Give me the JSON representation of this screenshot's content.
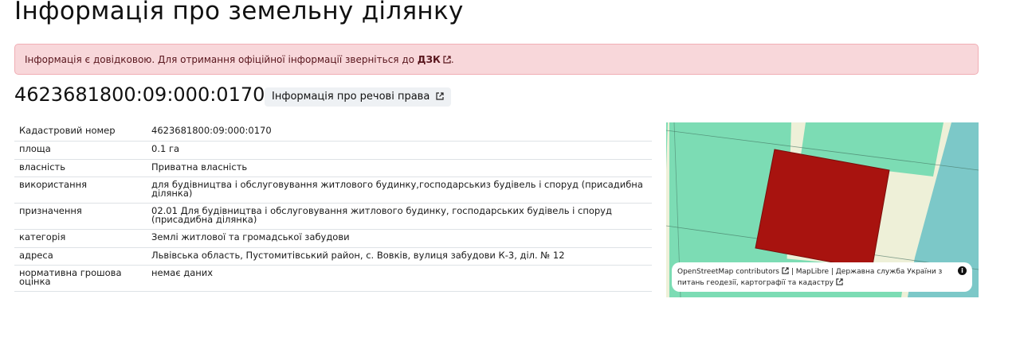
{
  "page": {
    "title": "Інформація про земельну ділянку"
  },
  "alert": {
    "text": "Інформація є довідковою. Для отримання офіційної інформації зверніться до ",
    "link_label": "ДЗК",
    "suffix": "."
  },
  "parcel": {
    "cadastral_number": "4623681800:09:000:0170",
    "rights_button_label": "Інформація про речові права"
  },
  "info_table": {
    "rows": [
      {
        "label": "Кадастровий номер",
        "value": "4623681800:09:000:0170"
      },
      {
        "label": "площа",
        "value": "0.1 га"
      },
      {
        "label": "власність",
        "value": "Приватна власність"
      },
      {
        "label": "використання",
        "value": "для будівництва і обслуговування житлового будинку,господарськиз будівель і споруд (присадибна ділянка)"
      },
      {
        "label": "призначення",
        "value": "02.01 Для будівництва і обслуговування житлового будинку, господарських будівель і споруд (присадибна ділянка)"
      },
      {
        "label": "категорія",
        "value": "Землі житлової та громадської забудови"
      },
      {
        "label": "адреса",
        "value": "Львівська область, Пустомитівський район, с. Вовків, вулиця забудови К-3, діл. № 12"
      },
      {
        "label": "нормативна грошова оцінка",
        "value": "немає даних"
      }
    ]
  },
  "map": {
    "attribution": {
      "osm": "OpenStreetMap contributors",
      "separator1": " | ",
      "maplibre": "MapLibre",
      "separator2": " | ",
      "agency": "Державна служба України з питань геодезії, картографії та кадастру"
    },
    "colors": {
      "parcel_fill": "#a8130f",
      "neighbor_fill": "#7cdcb4",
      "road_fill": "#eef0d8",
      "water_fill": "#7cc8c8"
    }
  }
}
